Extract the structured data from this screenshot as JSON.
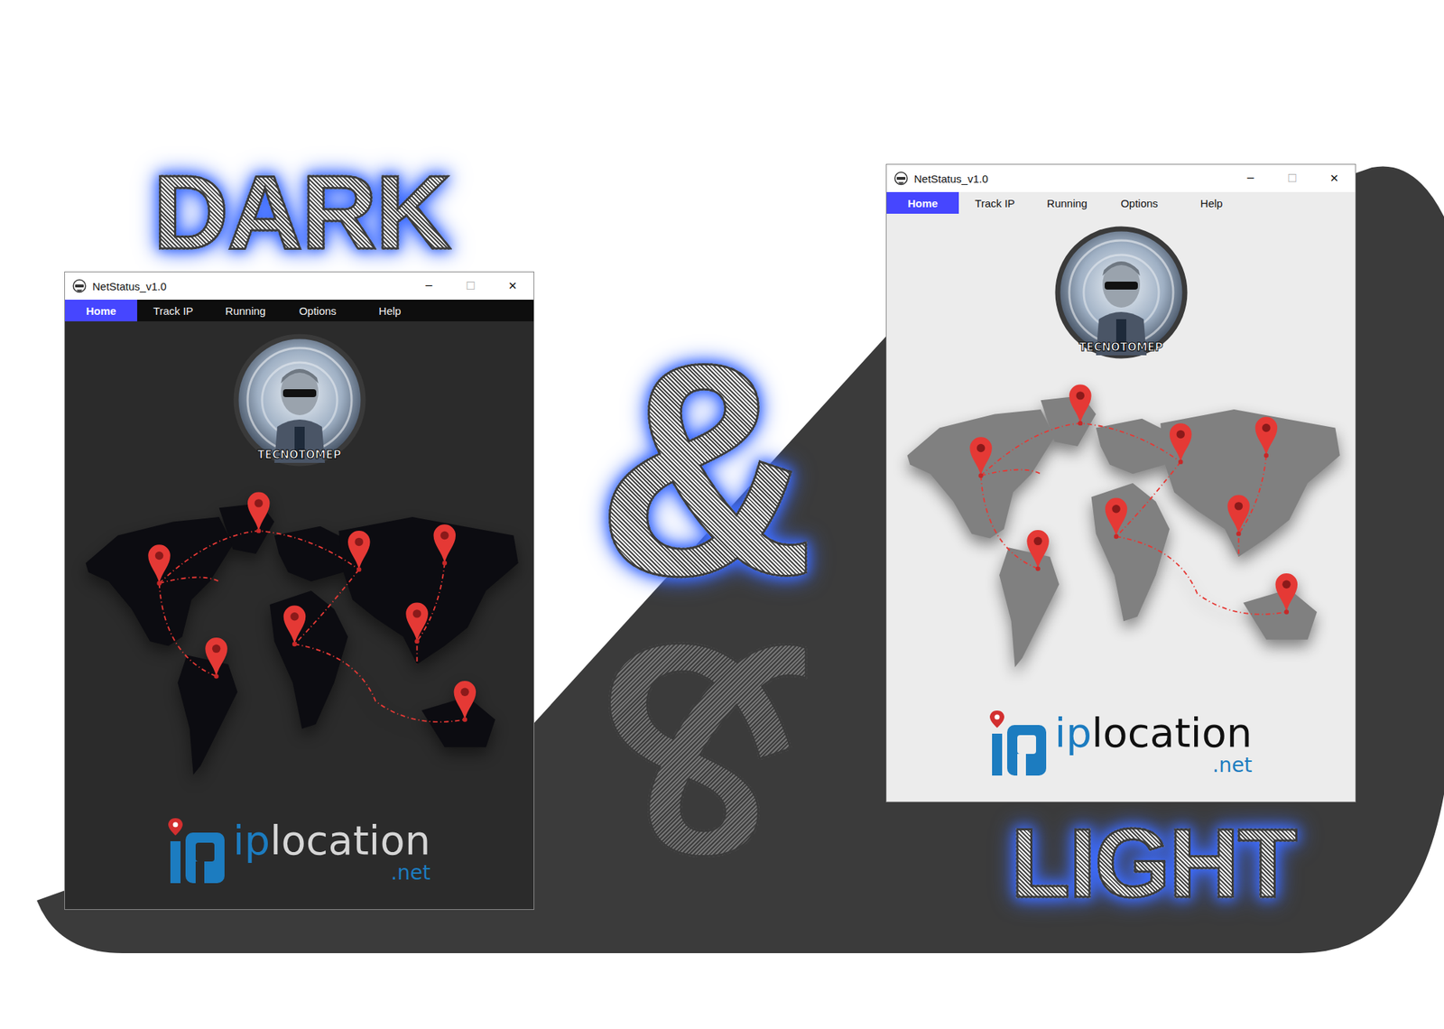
{
  "headings": {
    "dark": "DARK",
    "amp": "&",
    "light": "LIGHT"
  },
  "windows": [
    {
      "kind": "dark",
      "title": "NetStatus_v1.0",
      "controls": [
        {
          "label": "─",
          "disabled": false
        },
        {
          "label": "☐",
          "disabled": true
        },
        {
          "label": "✕",
          "disabled": false
        }
      ],
      "menu": [
        {
          "label": "Home",
          "selected": true
        },
        {
          "label": "Track IP",
          "selected": false
        },
        {
          "label": "Running",
          "selected": false
        },
        {
          "label": "Options",
          "selected": false
        },
        {
          "label": "Help",
          "selected": false
        }
      ],
      "avatar_text": "TECNOTOMEP",
      "logo": {
        "prefix": "ip",
        "main": "location",
        "suffix": ".net"
      }
    },
    {
      "kind": "light",
      "title": "NetStatus_v1.0",
      "controls": [
        {
          "label": "─",
          "disabled": false
        },
        {
          "label": "☐",
          "disabled": true
        },
        {
          "label": "✕",
          "disabled": false
        }
      ],
      "menu": [
        {
          "label": "Home",
          "selected": true
        },
        {
          "label": "Track IP",
          "selected": false
        },
        {
          "label": "Running",
          "selected": false
        },
        {
          "label": "Options",
          "selected": false
        },
        {
          "label": "Help",
          "selected": false
        }
      ],
      "avatar_text": "TECNOTOMEP",
      "logo": {
        "prefix": "ip",
        "main": "location",
        "suffix": ".net"
      }
    }
  ]
}
